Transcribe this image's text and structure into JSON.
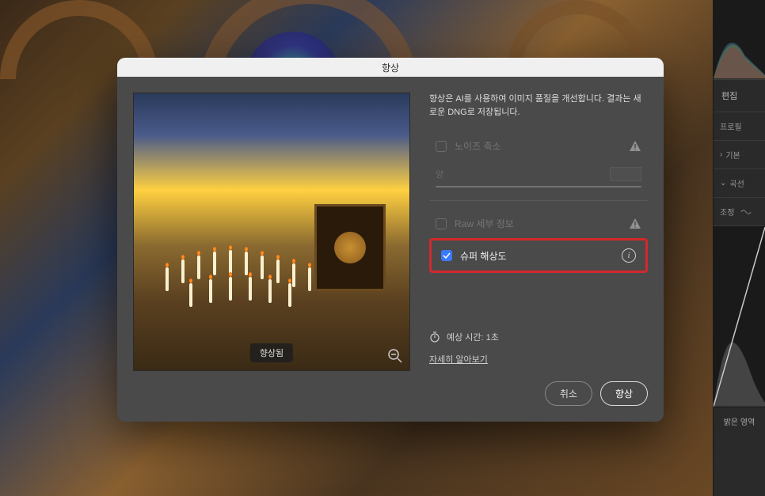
{
  "dialog": {
    "title": "향상",
    "description": "향상은 AI를 사용하여 이미지 품질을 개선합니다. 결과는 새로운 DNG로 저장됩니다.",
    "options": {
      "denoise": {
        "label": "노이즈 축소",
        "checked": false,
        "disabled": true
      },
      "amount": {
        "label": "양"
      },
      "raw_details": {
        "label": "Raw 세부 정보",
        "checked": false,
        "disabled": true
      },
      "super_resolution": {
        "label": "슈퍼 해상도",
        "checked": true
      }
    },
    "estimated_time": {
      "label": "예상 시간: 1초"
    },
    "learn_more": "자세히 알아보기",
    "preview_badge": "향상됨",
    "buttons": {
      "cancel": "취소",
      "enhance": "향상"
    }
  },
  "right_panel": {
    "edit": "편집",
    "profile": "프로필",
    "basic": "기본",
    "curve": "곡선",
    "adjust": "조정",
    "bright_region": "밝은 영역"
  }
}
